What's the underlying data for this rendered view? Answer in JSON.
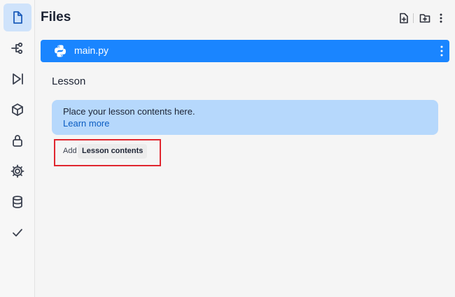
{
  "sidebar": {
    "items": [
      {
        "name": "files",
        "icon": "file-icon",
        "active": true
      },
      {
        "name": "version-control",
        "icon": "branch-icon",
        "active": false
      },
      {
        "name": "run",
        "icon": "play-step-icon",
        "active": false
      },
      {
        "name": "packages",
        "icon": "cube-icon",
        "active": false
      },
      {
        "name": "secrets",
        "icon": "lock-icon",
        "active": false
      },
      {
        "name": "settings",
        "icon": "gear-icon",
        "active": false
      },
      {
        "name": "database",
        "icon": "database-icon",
        "active": false
      },
      {
        "name": "tests",
        "icon": "check-icon",
        "active": false
      }
    ]
  },
  "header": {
    "title": "Files",
    "actions": [
      "new-file-icon",
      "new-folder-icon",
      "more-icon"
    ]
  },
  "files": [
    {
      "name": "main.py",
      "icon": "python-icon",
      "selected": true
    }
  ],
  "lesson": {
    "heading": "Lesson",
    "banner_text": "Place your lesson contents here.",
    "banner_link": "Learn more",
    "add_label": "Add",
    "add_chip": "Lesson contents"
  },
  "colors": {
    "accent": "#1a85ff",
    "banner_bg": "#b6d8fc",
    "highlight_border": "#e0262f"
  }
}
